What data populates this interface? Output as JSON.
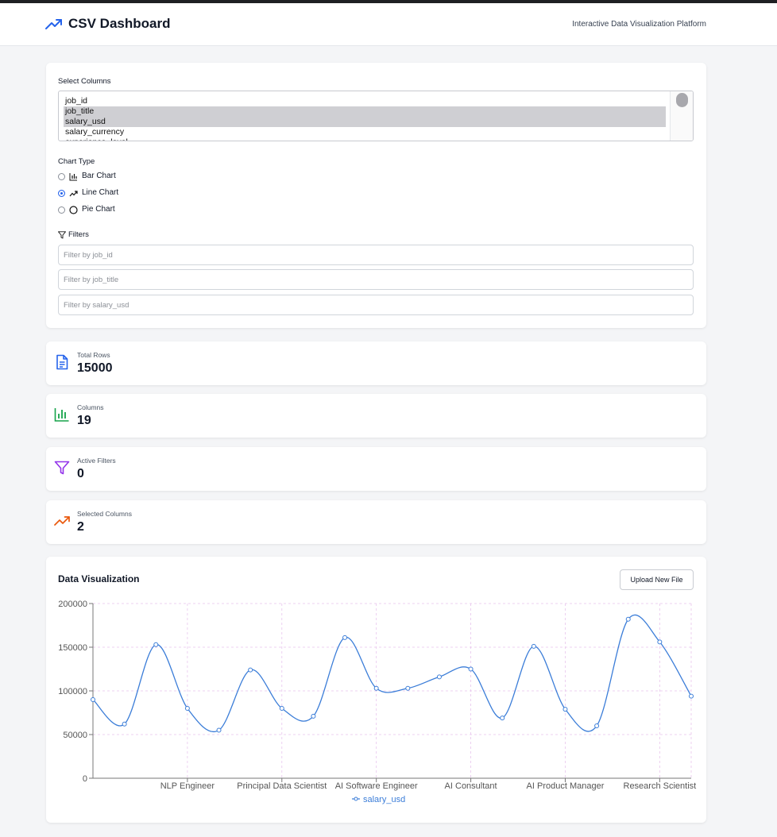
{
  "header": {
    "title": "CSV Dashboard",
    "subtitle": "Interactive Data Visualization Platform"
  },
  "controls": {
    "select_columns_label": "Select Columns",
    "columns": [
      {
        "label": "job_id",
        "selected": false
      },
      {
        "label": "job_title",
        "selected": true
      },
      {
        "label": "salary_usd",
        "selected": true
      },
      {
        "label": "salary_currency",
        "selected": false
      },
      {
        "label": "experience_level",
        "selected": false
      }
    ],
    "chart_type_label": "Chart Type",
    "chart_types": [
      {
        "label": "Bar Chart",
        "icon": "bar-chart-icon",
        "checked": false
      },
      {
        "label": "Line Chart",
        "icon": "trending-up-icon",
        "checked": true
      },
      {
        "label": "Pie Chart",
        "icon": "circle-icon",
        "checked": false
      }
    ],
    "filters_label": "Filters",
    "filters": [
      {
        "placeholder": "Filter by job_id",
        "value": ""
      },
      {
        "placeholder": "Filter by job_title",
        "value": ""
      },
      {
        "placeholder": "Filter by salary_usd",
        "value": ""
      }
    ]
  },
  "stats": [
    {
      "label": "Total Rows",
      "value": "15000",
      "icon": "file-text-icon",
      "color": "#2563eb"
    },
    {
      "label": "Columns",
      "value": "19",
      "icon": "bar-chart-icon",
      "color": "#16a34a"
    },
    {
      "label": "Active Filters",
      "value": "0",
      "icon": "filter-icon",
      "color": "#9333ea"
    },
    {
      "label": "Selected Columns",
      "value": "2",
      "icon": "trending-up-icon",
      "color": "#ea580c"
    }
  ],
  "visualization": {
    "title": "Data Visualization",
    "upload_label": "Upload New File"
  },
  "chart_data": {
    "type": "line",
    "x": [
      "",
      "",
      "",
      "NLP Engineer",
      "",
      "",
      "Principal Data Scientist",
      "",
      "",
      "AI Software Engineer",
      "",
      "",
      "AI Consultant",
      "",
      "",
      "AI Product Manager",
      "",
      "",
      "Research Scientist",
      "",
      ""
    ],
    "x_tick_labels": [
      "NLP Engineer",
      "Principal Data Scientist",
      "AI Software Engineer",
      "AI Consultant",
      "AI Product Manager",
      "Research Scientist"
    ],
    "series": [
      {
        "name": "salary_usd",
        "color": "#3b7dd8",
        "values": [
          90000,
          62000,
          153000,
          80000,
          55000,
          124000,
          80000,
          71000,
          161000,
          103000,
          103000,
          116000,
          125000,
          69000,
          151000,
          79000,
          60000,
          182000,
          156000,
          94000
        ]
      }
    ],
    "ylim": [
      0,
      200000
    ],
    "y_ticks": [
      0,
      50000,
      100000,
      150000,
      200000
    ],
    "grid": true,
    "legend": "bottom-center"
  }
}
